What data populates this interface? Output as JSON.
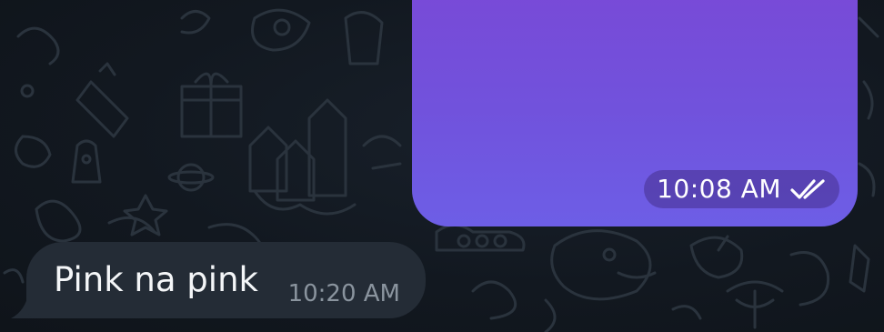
{
  "messages": [
    {
      "direction": "outgoing",
      "type": "media",
      "time": "10:08 AM",
      "status_icon": "double-check-icon",
      "colors": {
        "gradient_top": "#7a48d6",
        "gradient_bottom": "#6d5ee6"
      }
    },
    {
      "direction": "incoming",
      "type": "text",
      "text": "Pink na pink",
      "time": "10:20 AM",
      "colors": {
        "bubble": "#242c36",
        "text": "#f4f6f8",
        "time": "#8a949e"
      }
    }
  ],
  "theme": {
    "background": "#12171e",
    "doodle_stroke": "#2a333d"
  }
}
